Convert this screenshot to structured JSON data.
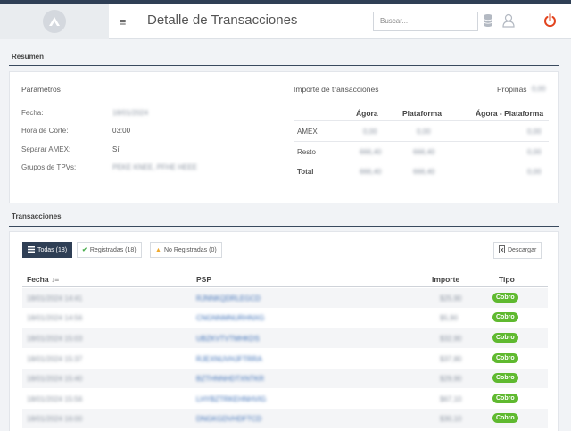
{
  "header": {
    "title": "Detalle de Transacciones",
    "search_placeholder": "Buscar..."
  },
  "resumen": {
    "section_title": "Resumen",
    "parametros_title": "Parámetros",
    "fecha_label": "Fecha:",
    "fecha_value": "18/01/2024",
    "hora_label": "Hora de Corte:",
    "hora_value": "03:00",
    "amex_label": "Separar AMEX:",
    "amex_value": "Sí",
    "grupos_label": "Grupos de TPVs:",
    "grupos_value": "PEKE KNEE, PFHE HEEE",
    "importe_title": "Importe de transacciones",
    "propinas_label": "Propinas",
    "propinas_value": "0,00",
    "col_agora": "Ágora",
    "col_plataforma": "Plataforma",
    "col_diff": "Ágora - Plataforma",
    "rows": [
      {
        "label": "AMEX",
        "agora": "0,00",
        "plataforma": "0,00",
        "diff": "0,00"
      },
      {
        "label": "Resto",
        "agora": "666,40",
        "plataforma": "666,40",
        "diff": "0,00"
      },
      {
        "label": "Total",
        "agora": "666,40",
        "plataforma": "666,40",
        "diff": "0,00"
      }
    ]
  },
  "transacciones": {
    "section_title": "Transacciones",
    "tab_todas": "Todas (18)",
    "tab_registradas": "Registradas (18)",
    "tab_no_registradas": "No Registradas (0)",
    "download_label": "Descargar",
    "col_fecha": "Fecha",
    "col_psp": "PSP",
    "col_importe": "Importe",
    "col_tipo": "Tipo",
    "rows": [
      {
        "fecha": "18/01/2024 14:41",
        "psp": "RJNNKQDRLEGCD",
        "importe": "$25,90",
        "tipo": "Cobro"
      },
      {
        "fecha": "18/01/2024 14:56",
        "psp": "CNGNNMNURHNXG",
        "importe": "$5,90",
        "tipo": "Cobro"
      },
      {
        "fecha": "18/01/2024 15:03",
        "psp": "UBZKVTVTMHKDS",
        "importe": "$32,90",
        "tipo": "Cobro"
      },
      {
        "fecha": "18/01/2024 15:37",
        "psp": "RJEXNUVHJFTRRA",
        "importe": "$37,80",
        "tipo": "Cobro"
      },
      {
        "fecha": "18/01/2024 15:40",
        "psp": "BZTHNNHDTXNTKR",
        "importe": "$29,90",
        "tipo": "Cobro"
      },
      {
        "fecha": "18/01/2024 15:56",
        "psp": "LHYBZTRKEHNHVIG",
        "importe": "$67,10",
        "tipo": "Cobro"
      },
      {
        "fecha": "18/01/2024 16:00",
        "psp": "DNGKGDVHDFTCD",
        "importe": "$30,10",
        "tipo": "Cobro"
      }
    ]
  },
  "colors": {
    "accent": "#2f3f55",
    "badge_green": "#5fb92f",
    "power_red": "#e2441f",
    "warning": "#f0a92d",
    "check_green": "#4caf50"
  }
}
